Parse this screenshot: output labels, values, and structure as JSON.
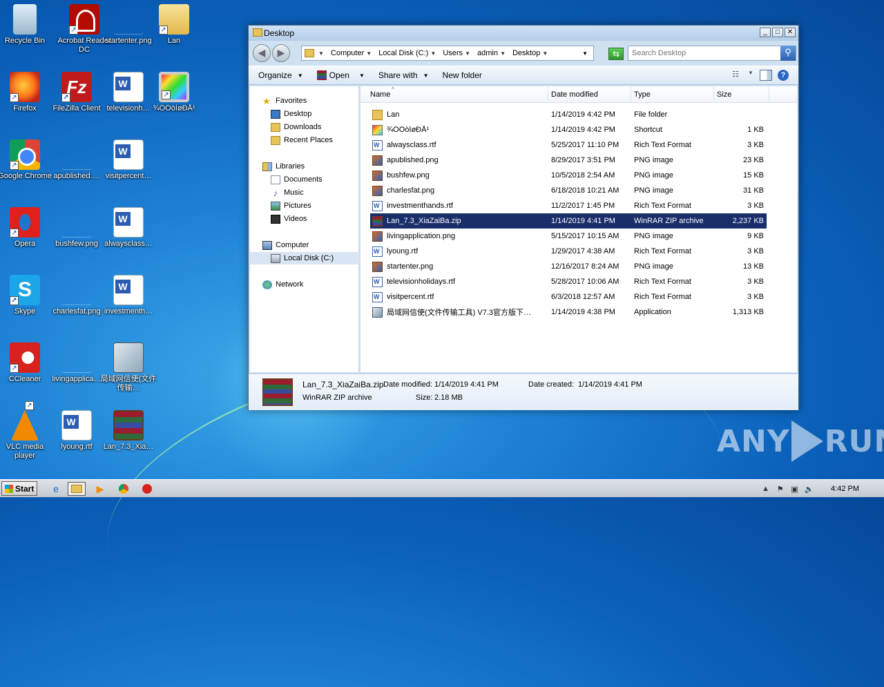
{
  "desktop": {
    "icons": [
      {
        "label": "Recycle Bin",
        "icon": "recycle-bin-icon"
      },
      {
        "label": "Acrobat Reader DC",
        "icon": "acrobat-icon"
      },
      {
        "label": "startenter.png",
        "icon": "png-file-icon"
      },
      {
        "label": "Lan",
        "icon": "folder-icon"
      },
      {
        "label": "Firefox",
        "icon": "firefox-icon"
      },
      {
        "label": "FileZilla Client",
        "icon": "filezilla-icon"
      },
      {
        "label": "televisionh…",
        "icon": "word-doc-icon"
      },
      {
        "label": "¾ÓÓòÍøÐÅ¹",
        "icon": "monitor-shortcut-icon"
      },
      {
        "label": "Google Chrome",
        "icon": "chrome-icon"
      },
      {
        "label": "apublished.…",
        "icon": "png-file-icon"
      },
      {
        "label": "visitpercent…",
        "icon": "word-doc-icon"
      },
      {
        "label": "Opera",
        "icon": "opera-icon"
      },
      {
        "label": "bushfew.png",
        "icon": "png-file-icon"
      },
      {
        "label": "alwaysclass…",
        "icon": "word-doc-icon"
      },
      {
        "label": "Skype",
        "icon": "skype-icon"
      },
      {
        "label": "charlesfat.png",
        "icon": "png-file-icon"
      },
      {
        "label": "investmenth…",
        "icon": "word-doc-icon"
      },
      {
        "label": "CCleaner",
        "icon": "ccleaner-icon"
      },
      {
        "label": "livingapplica…",
        "icon": "png-file-icon"
      },
      {
        "label": "局域网信使(文件传输…",
        "icon": "setup-app-icon"
      },
      {
        "label": "VLC media player",
        "icon": "vlc-icon"
      },
      {
        "label": "lyoung.rtf",
        "icon": "word-doc-icon"
      },
      {
        "label": "Lan_7.3_Xia…",
        "icon": "winrar-icon"
      }
    ],
    "watermark": "ANY RUN"
  },
  "window": {
    "title": "Desktop",
    "controls": {
      "minimize": "_",
      "maximize": "□",
      "close": "✕"
    },
    "address": {
      "crumbs": [
        "Computer",
        "Local Disk (C:)",
        "Users",
        "admin",
        "Desktop"
      ]
    },
    "search": {
      "placeholder": "Search Desktop"
    },
    "toolbar": {
      "organize": "Organize",
      "open": "Open",
      "share_with": "Share with",
      "new_folder": "New folder"
    },
    "nav": {
      "favorites": "Favorites",
      "desktop": "Desktop",
      "downloads": "Downloads",
      "recent_places": "Recent Places",
      "libraries": "Libraries",
      "documents": "Documents",
      "music": "Music",
      "pictures": "Pictures",
      "videos": "Videos",
      "computer": "Computer",
      "local_disk": "Local Disk (C:)",
      "network": "Network"
    },
    "columns": {
      "name": "Name",
      "date": "Date modified",
      "type": "Type",
      "size": "Size"
    },
    "files": [
      {
        "name": "Lan",
        "date": "1/14/2019 4:42 PM",
        "type": "File folder",
        "size": "",
        "icon": "folder-icon"
      },
      {
        "name": "¾ÓÓòÍøÐÅ¹",
        "date": "1/14/2019 4:42 PM",
        "type": "Shortcut",
        "size": "1 KB",
        "icon": "shortcut-icon"
      },
      {
        "name": "alwaysclass.rtf",
        "date": "5/25/2017 11:10 PM",
        "type": "Rich Text Format",
        "size": "3 KB",
        "icon": "rtf-icon"
      },
      {
        "name": "apublished.png",
        "date": "8/29/2017 3:51 PM",
        "type": "PNG image",
        "size": "23 KB",
        "icon": "png-icon"
      },
      {
        "name": "bushfew.png",
        "date": "10/5/2018 2:54 AM",
        "type": "PNG image",
        "size": "15 KB",
        "icon": "png-icon"
      },
      {
        "name": "charlesfat.png",
        "date": "6/18/2018 10:21 AM",
        "type": "PNG image",
        "size": "31 KB",
        "icon": "png-icon"
      },
      {
        "name": "investmenthands.rtf",
        "date": "11/2/2017 1:45 PM",
        "type": "Rich Text Format",
        "size": "3 KB",
        "icon": "rtf-icon"
      },
      {
        "name": "Lan_7.3_XiaZaiBa.zip",
        "date": "1/14/2019 4:41 PM",
        "type": "WinRAR ZIP archive",
        "size": "2,237 KB",
        "icon": "zip-icon"
      },
      {
        "name": "livingapplication.png",
        "date": "5/15/2017 10:15 AM",
        "type": "PNG image",
        "size": "9 KB",
        "icon": "png-icon"
      },
      {
        "name": "lyoung.rtf",
        "date": "1/29/2017 4:38 AM",
        "type": "Rich Text Format",
        "size": "3 KB",
        "icon": "rtf-icon"
      },
      {
        "name": "startenter.png",
        "date": "12/16/2017 8:24 AM",
        "type": "PNG image",
        "size": "13 KB",
        "icon": "png-icon"
      },
      {
        "name": "televisionholidays.rtf",
        "date": "5/28/2017 10:06 AM",
        "type": "Rich Text Format",
        "size": "3 KB",
        "icon": "rtf-icon"
      },
      {
        "name": "visitpercent.rtf",
        "date": "6/3/2018 12:57 AM",
        "type": "Rich Text Format",
        "size": "3 KB",
        "icon": "rtf-icon"
      },
      {
        "name": "局域网信使(文件传输工具) V7.3官方版下…",
        "date": "1/14/2019 4:38 PM",
        "type": "Application",
        "size": "1,313 KB",
        "icon": "app-icon"
      }
    ],
    "details": {
      "name": "Lan_7.3_XiaZaiBa.zip",
      "type": "WinRAR ZIP archive",
      "date_modified_label": "Date modified:",
      "date_modified": "1/14/2019 4:41 PM",
      "date_created_label": "Date created:",
      "date_created": "1/14/2019 4:41 PM",
      "size_label": "Size:",
      "size": "2.18 MB"
    }
  },
  "taskbar": {
    "start": "Start",
    "clock": "4:42 PM"
  }
}
